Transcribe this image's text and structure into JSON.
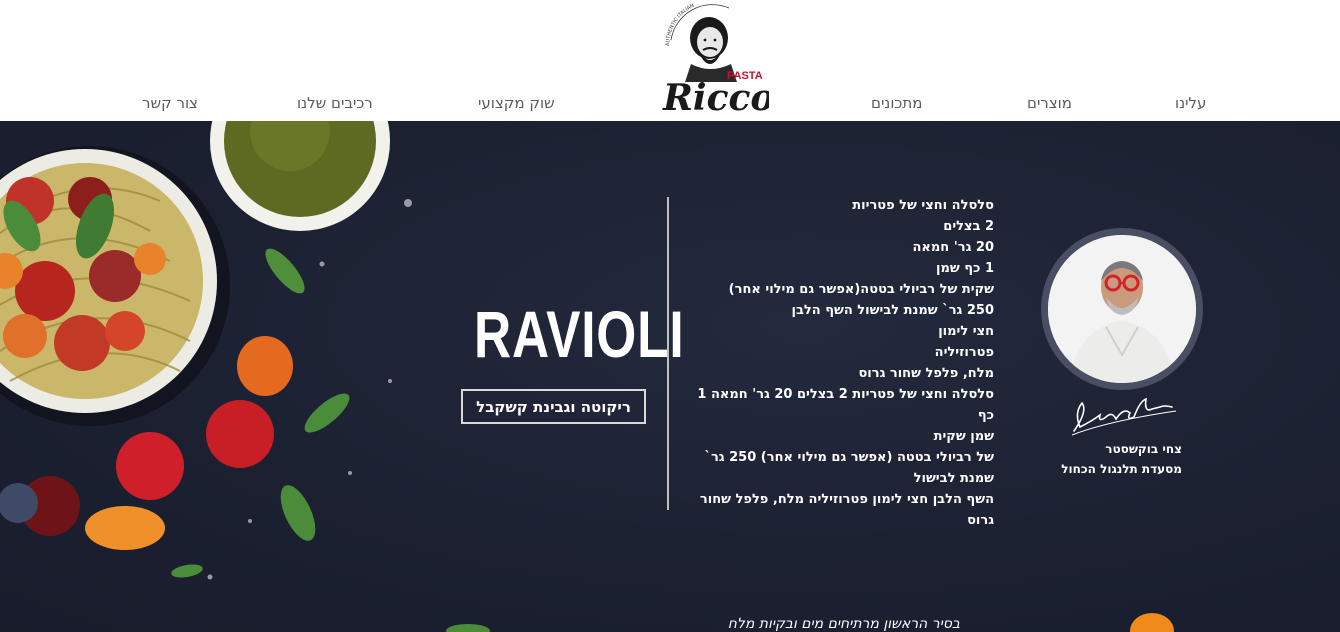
{
  "brand": {
    "name": "Ricco",
    "tag": "PASTA",
    "ring_text": "AUTHENTIC ITALIAN"
  },
  "nav": {
    "about": "עלינו",
    "products": "מוצרים",
    "recipes": "מתכונים",
    "market": "שוק מקצועי",
    "ingredients": "רכיבים שלנו",
    "contact": "צור קשר"
  },
  "recipe": {
    "title": "RAVIOLI",
    "subtitle": "ריקוטה וגבינת קשקבל",
    "ingredients": [
      "סלסלה וחצי של פטריות",
      "2 בצלים",
      "20 גר' חמאה",
      "1 כף שמן",
      "שקית של רביולי בטטה(אפשר גם מילוי אחר)",
      "250 גר` שמנת לבישול השף הלבן",
      "חצי לימון",
      "פטרוזיליה",
      "מלח, פלפל שחור גרוס",
      "סלסלה וחצי של פטריות 2 בצלים 20 גר' חמאה 1 כף",
      "שמן שקית",
      "של רביולי בטטה (אפשר גם מילוי אחר) 250 גר`",
      "שמנת לבישול",
      "השף הלבן חצי לימון פטרוזיליה מלח, פלפל שחור",
      "גרוס"
    ]
  },
  "chef": {
    "name": "צחי בוקשסטר",
    "restaurant": "מסעדת תלנגול הכחול"
  },
  "bottom_text": "בסיר הראשון מרתיחים מים ובקיות מלח",
  "colors": {
    "band_bg": "#1c2132",
    "text_white": "#ffffff",
    "nav_text": "#5a5a5a",
    "brand_red": "#c8102e",
    "frame": "#4a4e63"
  }
}
